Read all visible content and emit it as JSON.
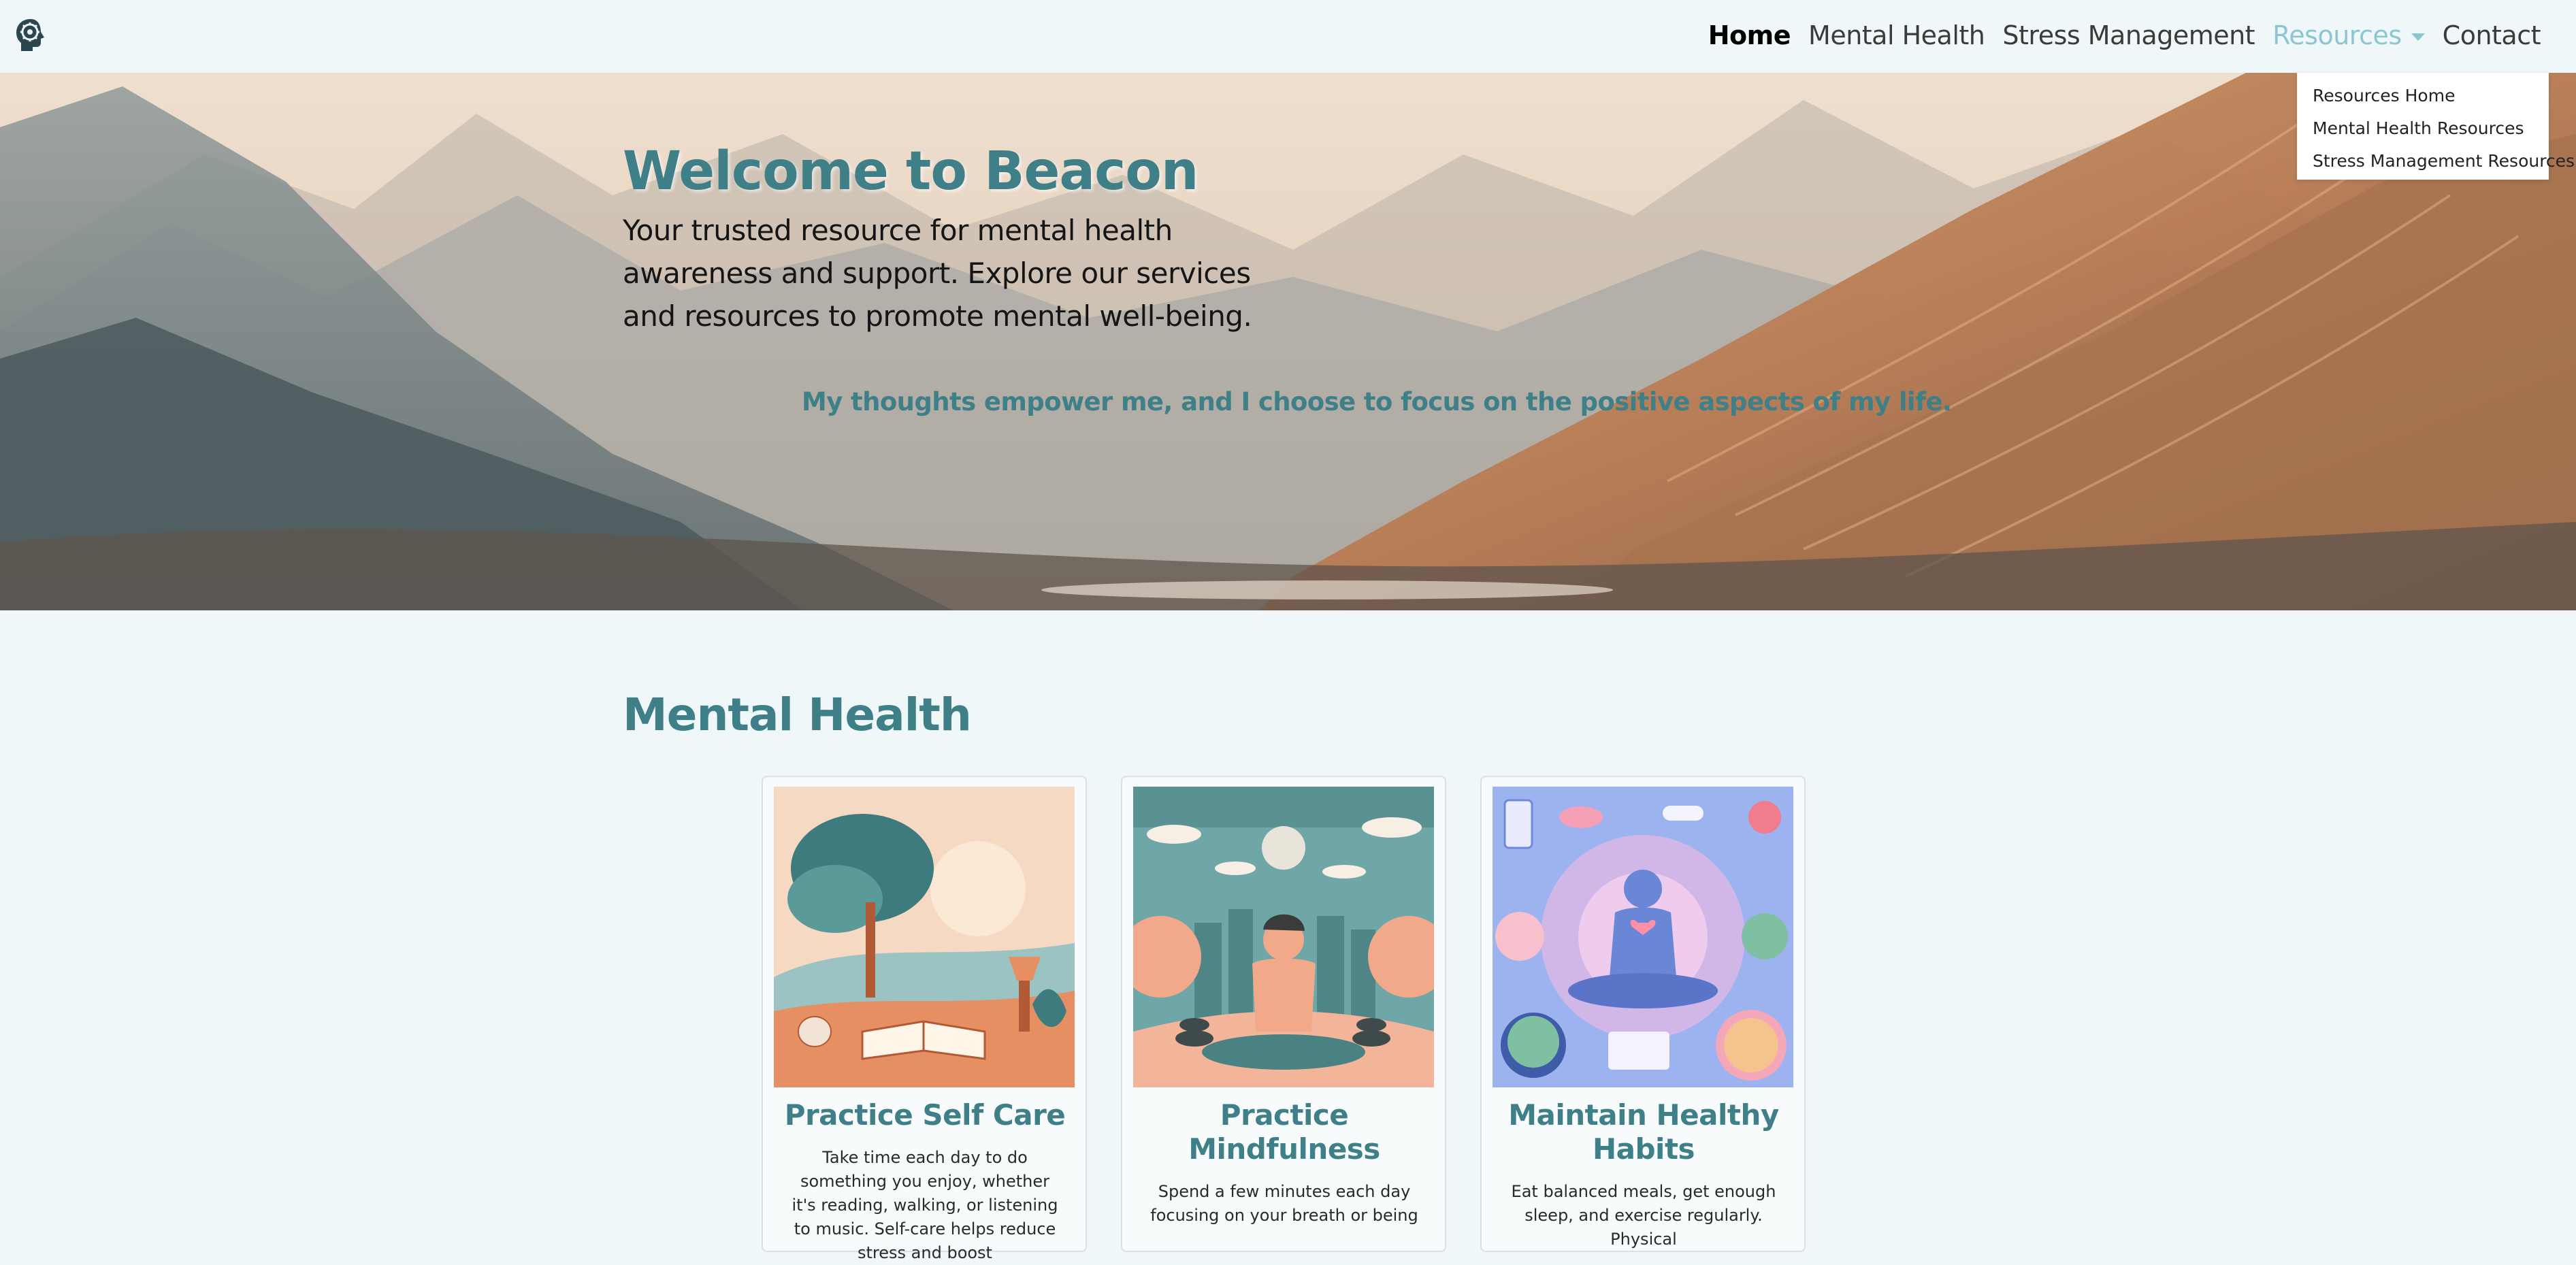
{
  "nav": {
    "logo_icon": "brain-gear-icon",
    "items": [
      {
        "label": "Home"
      },
      {
        "label": "Mental Health"
      },
      {
        "label": "Stress Management"
      },
      {
        "label": "Resources"
      },
      {
        "label": "Contact"
      }
    ],
    "dropdown": [
      "Resources Home",
      "Mental Health Resources",
      "Stress Management Resources"
    ]
  },
  "hero": {
    "title": "Welcome to Beacon",
    "subtitle": "Your trusted resource for mental health awareness and support. Explore our services and resources to promote mental well-being.",
    "quote": "My thoughts empower me, and I choose to focus on the positive aspects of my life."
  },
  "section": {
    "title": "Mental Health",
    "cards": [
      {
        "title": "Practice Self Care",
        "text": "Take time each day to do something you enjoy, whether it's reading, walking, or listening to music. Self-care helps reduce stress and boost"
      },
      {
        "title": "Practice Mindfulness",
        "text": "Spend a few minutes each day focusing on your breath or being"
      },
      {
        "title": "Maintain Healthy Habits",
        "text": "Eat balanced meals, get enough sleep, and exercise regularly. Physical"
      }
    ]
  },
  "colors": {
    "accent": "#3f7f88",
    "page_background": "#f0f7f8",
    "dropdown_active": "#8cc6d3"
  }
}
